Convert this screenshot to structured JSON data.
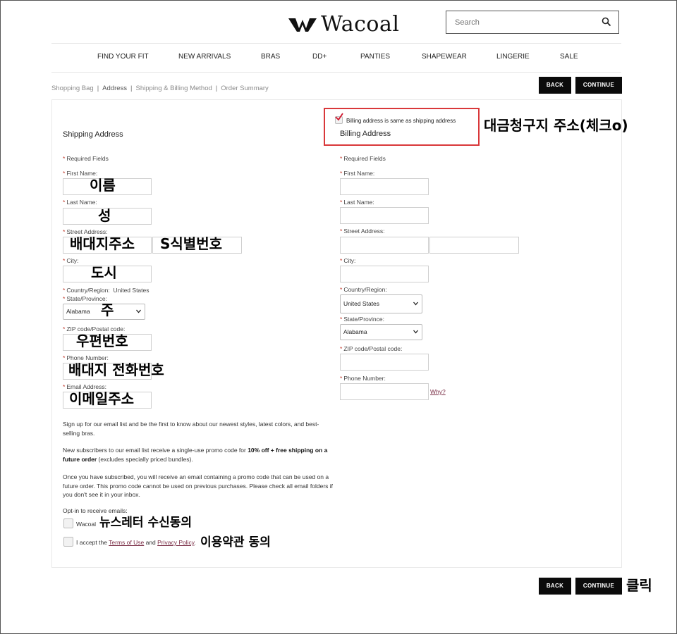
{
  "header": {
    "logo_text": "Wacoal",
    "search_placeholder": "Search"
  },
  "nav": [
    "FIND YOUR FIT",
    "NEW ARRIVALS",
    "BRAS",
    "DD+",
    "PANTIES",
    "SHAPEWEAR",
    "LINGERIE",
    "SALE"
  ],
  "breadcrumb": {
    "shopping_bag": "Shopping Bag",
    "address": "Address",
    "shipping_billing": "Shipping & Billing Method",
    "order_summary": "Order Summary",
    "sep": "|"
  },
  "buttons": {
    "back": "BACK",
    "continue": "CONTINUE"
  },
  "required_mark": "*",
  "shipping": {
    "title": "Shipping Address",
    "required_fields": "Required Fields",
    "first_name": "First Name:",
    "last_name": "Last Name:",
    "street": "Street Address:",
    "city": "City:",
    "country_label": "Country/Region:",
    "country_value": "United States",
    "state": "State/Province:",
    "state_value": "Alabama",
    "zip": "ZIP code/Postal code:",
    "phone": "Phone Number:",
    "email": "Email Address:"
  },
  "billing": {
    "same_checkbox": "Billing address is same as shipping address",
    "title": "Billing Address",
    "required_fields": "Required Fields",
    "first_name": "First Name:",
    "last_name": "Last Name:",
    "street": "Street Address:",
    "city": "City:",
    "country": "Country/Region:",
    "country_value": "United States",
    "state": "State/Province:",
    "state_value": "Alabama",
    "zip": "ZIP code/Postal code:",
    "phone": "Phone Number:",
    "why": "Why?"
  },
  "signup": {
    "p1": "Sign up for our email list and be the first to know about our newest styles, latest colors, and best-selling bras.",
    "p2_pre": "New subscribers to our email list receive a single-use promo code for ",
    "p2_bold": "10% off + free shipping on a future order",
    "p2_post": " (excludes specially priced bundles).",
    "p3": "Once you have subscribed, you will receive an email containing a promo code that can be used on a future order. This promo code cannot be used on previous purchases. Please check all email folders if you don't see it in your inbox.",
    "optin": "Opt-in to receive emails:",
    "wacoal": "Wacoal",
    "accept_pre": "I accept the ",
    "terms": "Terms of Use",
    "and": " and ",
    "privacy": "Privacy Policy",
    "period": "."
  },
  "annotations": {
    "first_name": "이름",
    "last_name": "성",
    "street": "배대지주소",
    "street2": "S식별번호",
    "city": "도시",
    "state": "주",
    "zip": "우편번호",
    "phone": "배대지 전화번호",
    "email": "이메일주소",
    "billing": "대금청구지 주소(체크o)",
    "newsletter": "뉴스레터 수신동의",
    "terms": "이용약관 동의",
    "click": "클릭"
  },
  "colors": {
    "required": "#c0392b",
    "button": "#0b0b0b",
    "highlight_box": "#d9383a",
    "link": "#7a2d45"
  }
}
